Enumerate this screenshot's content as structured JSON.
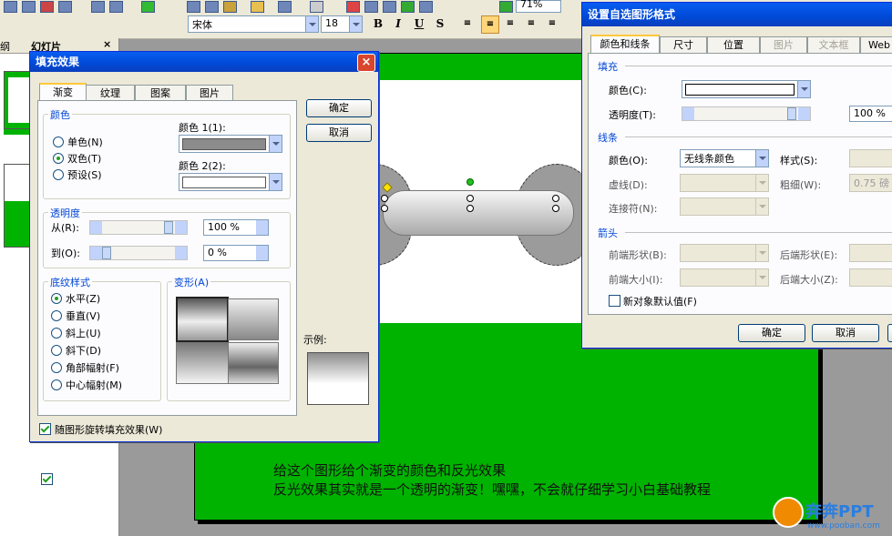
{
  "toolbar": {
    "font_name": "宋体",
    "font_size": "18",
    "zoom": "71%",
    "bold": "B",
    "italic": "I",
    "underline": "U",
    "shadow": "S"
  },
  "left_panel": {
    "tab_outline": "纲",
    "tab_slides": "幻灯片",
    "close": "×"
  },
  "slide": {
    "line1": "给这个图形给个渐变的颜色和反光效果",
    "line2": "反光效果其实就是一个透明的渐变！嘿嘿，不会就仔细学习小白基础教程"
  },
  "fill_dialog": {
    "title": "填充效果",
    "close": "×",
    "tabs": [
      "渐变",
      "纹理",
      "图案",
      "图片"
    ],
    "ok": "确定",
    "cancel": "取消",
    "colors_group": "颜色",
    "radio_single": "单色(N)",
    "radio_two": "双色(T)",
    "radio_preset": "预设(S)",
    "color1_label": "颜色 1(1):",
    "color2_label": "颜色 2(2):",
    "transparency_group": "透明度",
    "from_label": "从(R):",
    "to_label": "到(O):",
    "from_value": "100 %",
    "to_value": "0 %",
    "from_fraction": 1.0,
    "to_fraction": 0.0,
    "shading_group": "底纹样式",
    "shading_styles": [
      "水平(Z)",
      "垂直(V)",
      "斜上(U)",
      "斜下(D)",
      "角部幅射(F)",
      "中心幅射(M)"
    ],
    "variants_group": "变形(A)",
    "sample_label": "示例:",
    "rotate_checkbox": "随图形旋转填充效果(W)",
    "color1_value": "#8c8c8c",
    "color2_value": "#ffffff"
  },
  "format_dialog": {
    "title": "设置自选图形格式",
    "tabs": [
      "颜色和线条",
      "尺寸",
      "位置",
      "图片",
      "文本框",
      "Web"
    ],
    "fill_section": "填充",
    "fill_color_label": "颜色(C):",
    "fill_transparency_label": "透明度(T):",
    "fill_transparency_value": "100 %",
    "fill_transparency_fraction": 1.0,
    "line_section": "线条",
    "line_color_label": "颜色(O):",
    "line_color_value": "无线条颜色",
    "line_style_label": "样式(S):",
    "dash_label": "虚线(D):",
    "weight_label": "粗细(W):",
    "weight_value": "0.75 磅",
    "connector_label": "连接符(N):",
    "arrows_section": "箭头",
    "begin_style_label": "前端形状(B):",
    "end_style_label": "后端形状(E):",
    "begin_size_label": "前端大小(I):",
    "end_size_label": "后端大小(Z):",
    "default_checkbox": "新对象默认值(F)",
    "ok": "确定",
    "cancel": "取消"
  },
  "watermark": {
    "brand": "奔奔PPT",
    "url": "www.pooban.com"
  },
  "colors": {
    "slide_green": "#00b300",
    "title_blue": "#0049d6",
    "section_blue": "#0046d5"
  }
}
